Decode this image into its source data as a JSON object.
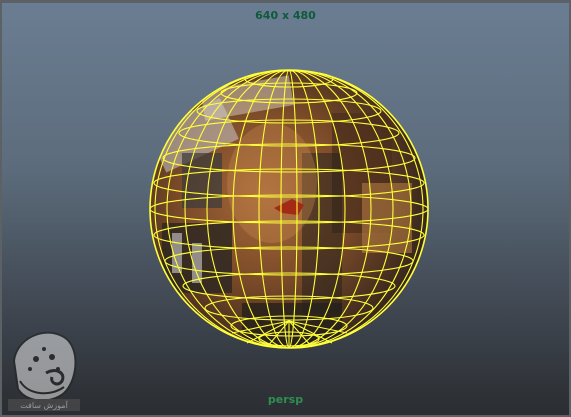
{
  "viewport": {
    "resolution_gate": "640 x 480",
    "camera_name": "persp"
  },
  "colors": {
    "wireframe": "#ffff3a",
    "resolution_label": "#0f5a3c",
    "camera_label": "#2f8f52"
  },
  "watermark": {
    "caption": "آموزش سافت"
  }
}
